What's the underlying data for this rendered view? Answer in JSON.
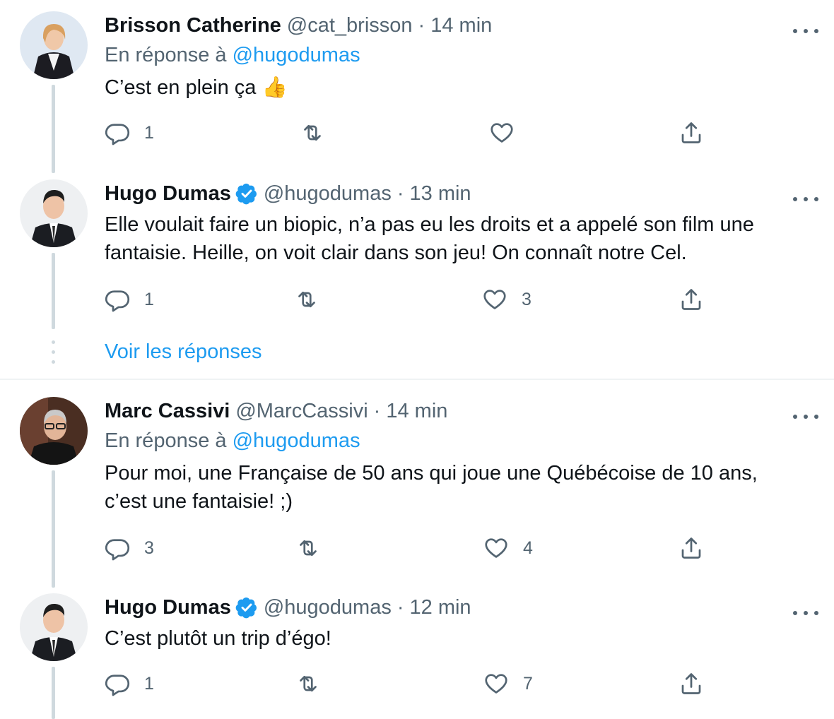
{
  "tweets": [
    {
      "name": "Brisson Catherine",
      "handle": "@cat_brisson",
      "sep": "·",
      "time": "14 min",
      "reply_prefix": "En réponse à",
      "reply_mention": "@hugodumas",
      "text": "C’est en plein ça 👍",
      "replies": "1",
      "retweets": "",
      "likes": ""
    },
    {
      "name": "Hugo Dumas",
      "handle": "@hugodumas",
      "sep": "·",
      "time": "13 min",
      "text_line1": "Elle voulait faire un biopic, n’a pas eu les droits et a appelé son film une",
      "text_line2": "fantaisie. Heille, on voit clair dans son jeu! On connaît notre Cel.",
      "replies": "1",
      "retweets": "",
      "likes": "3"
    },
    {
      "name": "Marc Cassivi",
      "handle": "@MarcCassivi",
      "sep": "·",
      "time": "14 min",
      "reply_prefix": "En réponse à",
      "reply_mention": "@hugodumas",
      "text_line1": "Pour moi, une Française de 50 ans qui joue une Québécoise de 10 ans,",
      "text_line2": "c’est une fantaisie! ;)",
      "replies": "3",
      "retweets": "",
      "likes": "4"
    },
    {
      "name": "Hugo Dumas",
      "handle": "@hugodumas",
      "sep": "·",
      "time": "12 min",
      "text": "C’est plutôt un trip d’égo!",
      "replies": "1",
      "retweets": "",
      "likes": "7"
    }
  ],
  "show_replies": "Voir les réponses",
  "colors": {
    "accent": "#1d9bf0",
    "secondary_text": "#536471",
    "thread_line": "#cfd9de"
  },
  "icons": [
    "reply-icon",
    "retweet-icon",
    "like-icon",
    "share-icon",
    "more-icon",
    "verified-badge-icon"
  ]
}
